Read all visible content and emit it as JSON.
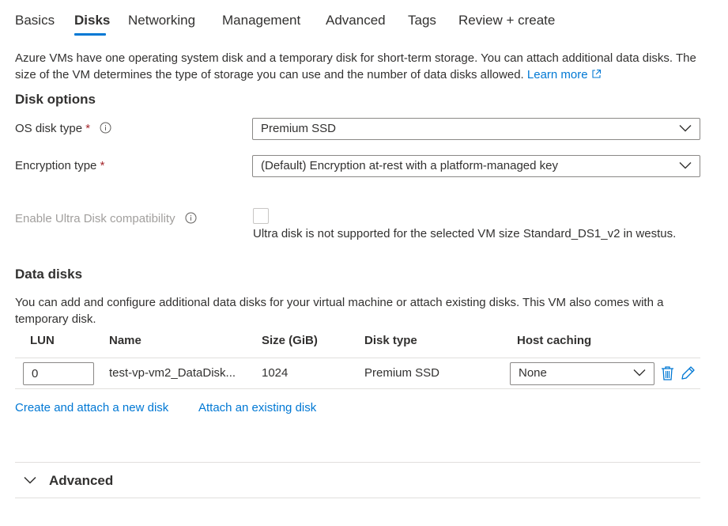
{
  "tabs": [
    {
      "label": "Basics",
      "active": false
    },
    {
      "label": "Disks",
      "active": true
    },
    {
      "label": "Networking",
      "active": false
    },
    {
      "label": "Management",
      "active": false
    },
    {
      "label": "Advanced",
      "active": false
    },
    {
      "label": "Tags",
      "active": false
    },
    {
      "label": "Review + create",
      "active": false
    }
  ],
  "intro": {
    "text": "Azure VMs have one operating system disk and a temporary disk for short-term storage. You can attach additional data disks. The size of the VM determines the type of storage you can use and the number of data disks allowed.",
    "link": "Learn more"
  },
  "disk_options": {
    "title": "Disk options",
    "os_disk_type": {
      "label": "OS disk type",
      "required": "*",
      "value": "Premium SSD"
    },
    "encryption_type": {
      "label": "Encryption type",
      "required": "*",
      "value": "(Default) Encryption at-rest with a platform-managed key"
    },
    "ultra_disk": {
      "label": "Enable Ultra Disk compatibility",
      "checked": false,
      "note": "Ultra disk is not supported for the selected VM size Standard_DS1_v2 in westus."
    }
  },
  "data_disks": {
    "title": "Data disks",
    "description": "You can add and configure additional data disks for your virtual machine or attach existing disks. This VM also comes with a temporary disk.",
    "columns": [
      "LUN",
      "Name",
      "Size (GiB)",
      "Disk type",
      "Host caching"
    ],
    "rows": [
      {
        "lun": "0",
        "name": "test-vp-vm2_DataDisk...",
        "size": "1024",
        "disk_type": "Premium SSD",
        "host_caching": "None"
      }
    ],
    "create_link": "Create and attach a new disk",
    "attach_link": "Attach an existing disk"
  },
  "advanced": {
    "label": "Advanced",
    "expanded": false
  },
  "colors": {
    "accent": "#0078d4",
    "required": "#a4262c",
    "disabled_text": "#a19f9d",
    "text": "#323130"
  }
}
